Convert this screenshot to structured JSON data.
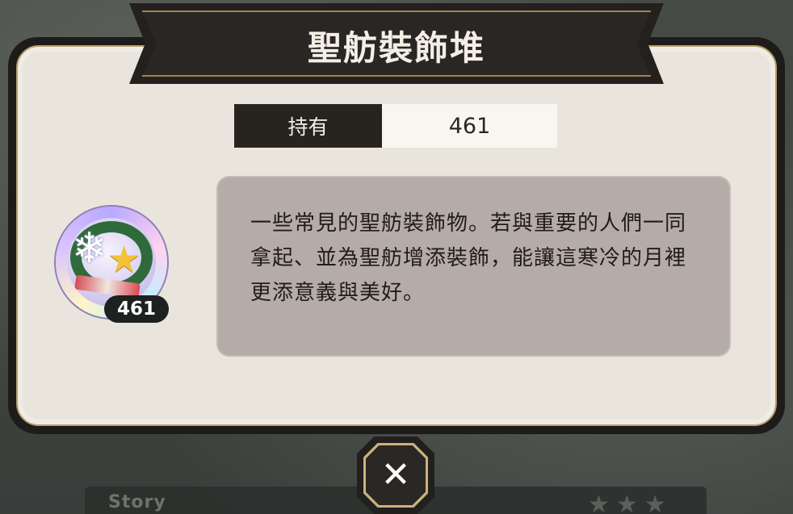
{
  "dialog": {
    "title": "聖舫裝飾堆",
    "owned_label": "持有",
    "owned_value": "461",
    "description": "一些常見的聖舫裝飾物。若與重要的人們一同拿起、並為聖舫增添裝飾，能讓這寒冷的月裡更添意義與美好。",
    "item_icon": "snowflake-star-wreath-icon",
    "item_count": "461",
    "close_icon": "close-x-icon"
  },
  "background": {
    "story_label": "Story",
    "stars": "★★★"
  },
  "colors": {
    "panel_dark": "#1e1c1a",
    "panel_light": "#e9e5dc",
    "gold_trim": "#b79f6b",
    "description_box": "#b6aca7"
  }
}
